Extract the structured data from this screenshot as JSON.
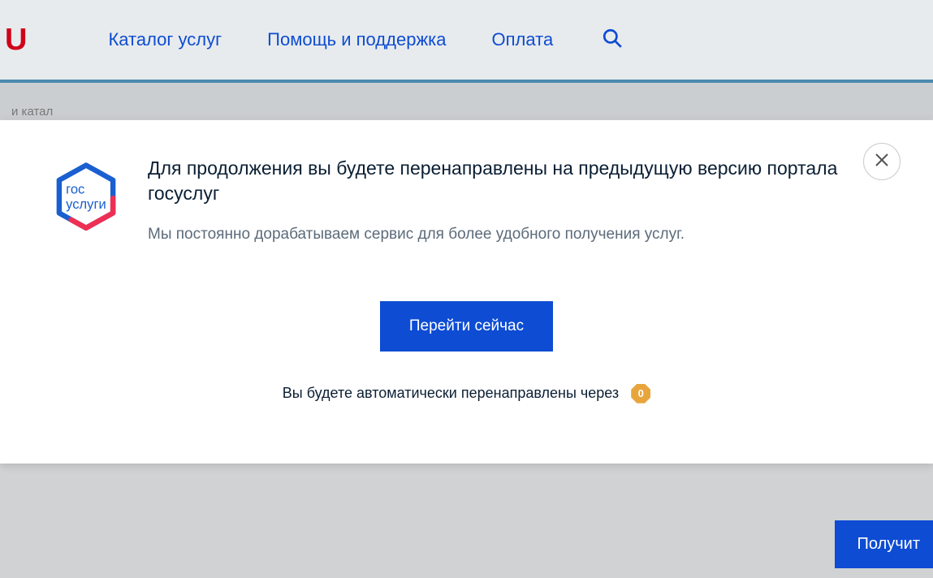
{
  "header": {
    "logo_fragment": "U",
    "nav": {
      "catalog": "Каталог услуг",
      "help": "Помощь и поддержка",
      "payment": "Оплата"
    }
  },
  "breadcrumb": {
    "partial": "и катал"
  },
  "modal": {
    "logo_top": "гос",
    "logo_bottom": "услуги",
    "title": "Для продолжения вы будете перенаправлены на предыдущую версию портала госуслуг",
    "subtitle": "Мы постоянно дорабатываем сервис для более удобного получения услуг.",
    "go_now_label": "Перейти сейчас",
    "countdown_text": "Вы будете автоматически перенаправлены через",
    "countdown_value": "0"
  },
  "bottom_button_label": "Получит"
}
